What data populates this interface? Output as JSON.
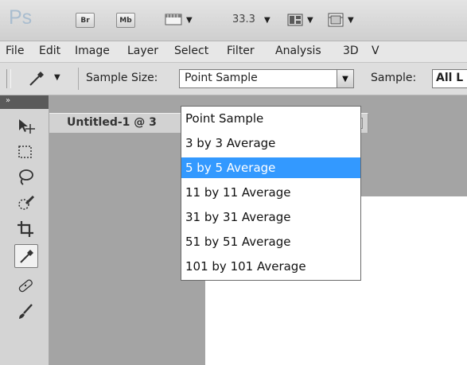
{
  "app": {
    "logo": "Ps",
    "bridge_button": "Br",
    "mini_bridge_button": "Mb",
    "zoom_value": "33.3"
  },
  "menu": [
    "File",
    "Edit",
    "Image",
    "Layer",
    "Select",
    "Filter",
    "Analysis",
    "3D",
    "V"
  ],
  "options_bar": {
    "sample_size_label": "Sample Size:",
    "sample_size_value": "Point Sample",
    "sample_label": "Sample:",
    "sample_value": "All L"
  },
  "document": {
    "tab_title": "Untitled-1 @ 3",
    "tab_close_glyph": "✕"
  },
  "dropdown": {
    "options": [
      "Point Sample",
      "3 by 3 Average",
      "5 by 5 Average",
      "11 by 11 Average",
      "31 by 31 Average",
      "51 by 51 Average",
      "101 by 101 Average"
    ],
    "highlighted": "5 by 5 Average"
  },
  "colors": {
    "highlight": "#3399ff",
    "workspace_gray": "#a4a4a4"
  },
  "icons": {
    "move": "move-tool-icon",
    "marquee": "marquee-tool-icon",
    "lasso": "lasso-tool-icon",
    "quick_select": "quick-selection-tool-icon",
    "crop": "crop-tool-icon",
    "eyedropper": "eyedropper-tool-icon",
    "healing": "healing-brush-tool-icon",
    "brush": "brush-tool-icon"
  }
}
